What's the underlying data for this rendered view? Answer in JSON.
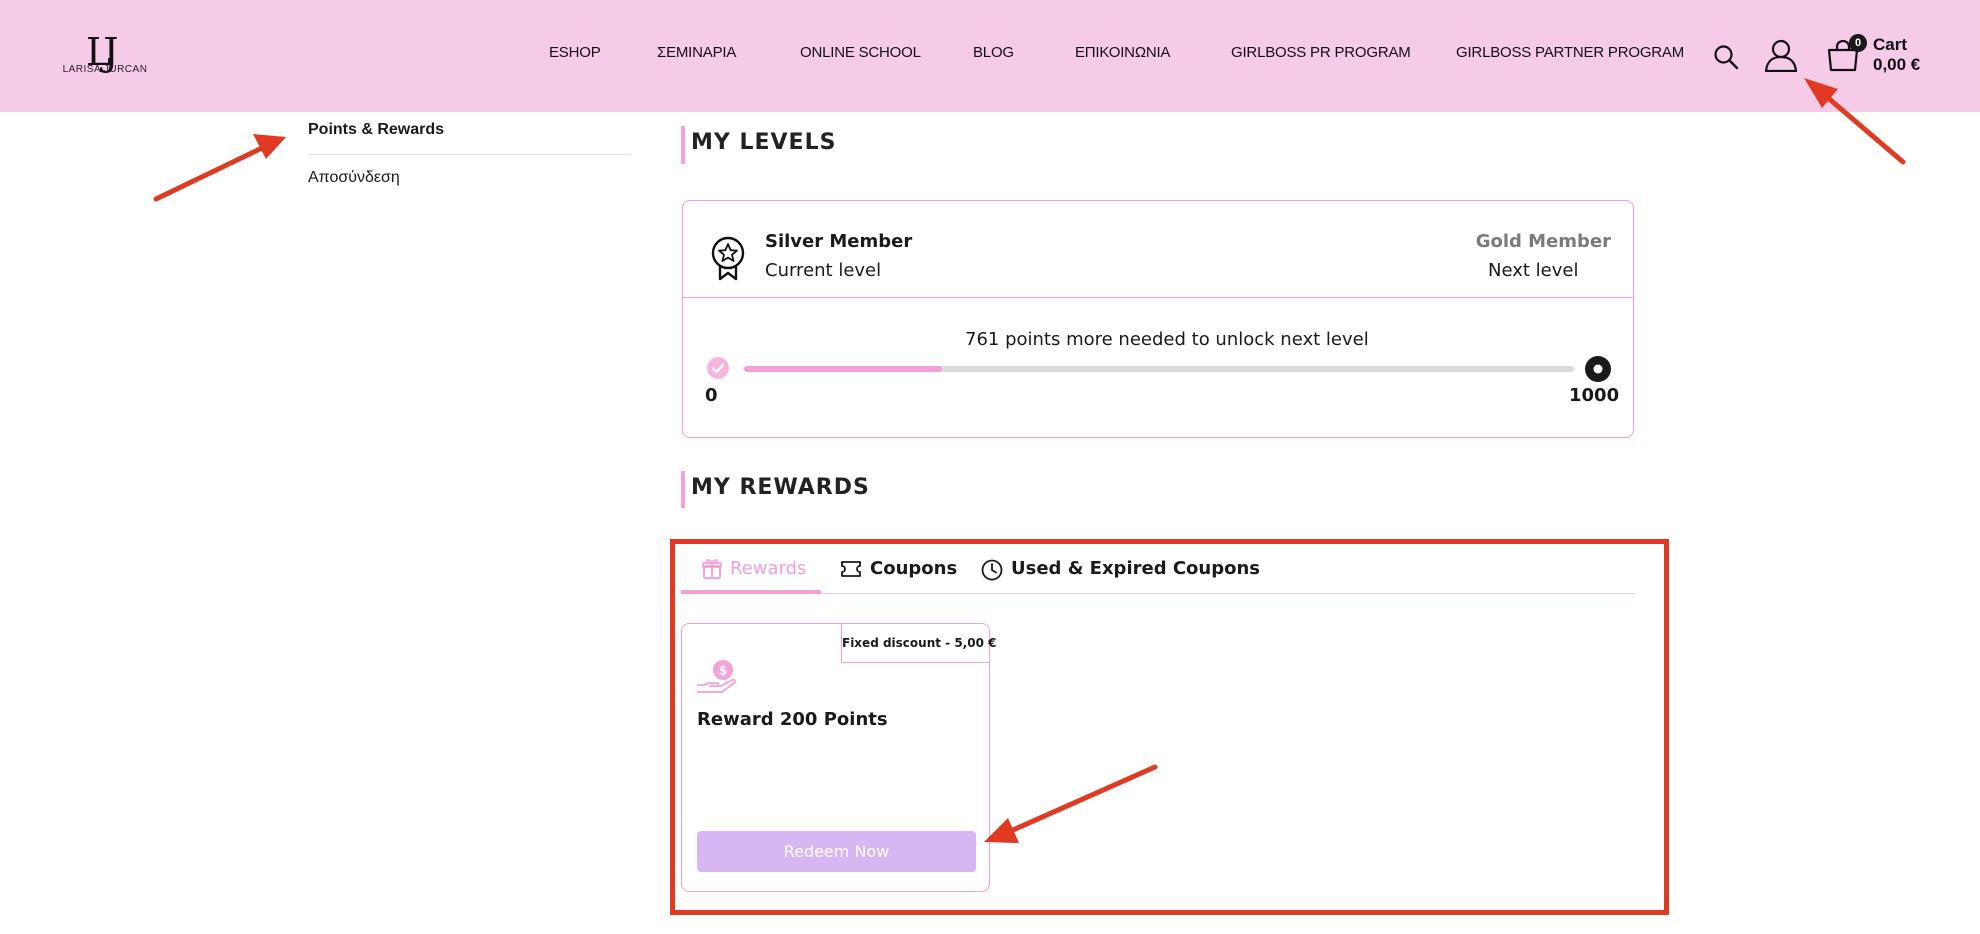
{
  "header": {
    "logo_text": "LJ",
    "logo_brand": "LARISA JURCAN",
    "nav": [
      "ESHOP",
      "ΣΕΜΙΝΑΡΙΑ",
      "ONLINE SCHOOL",
      "BLOG",
      "ΕΠΙΚΟΙΝΩΝΙΑ",
      "GIRLBOSS PR PROGRAM",
      "GIRLBOSS PARTNER PROGRAM"
    ],
    "icons": [
      "search-icon",
      "user-icon",
      "bag-icon"
    ],
    "cart_count": "0",
    "cart_label": "Cart",
    "cart_total": "0,00 €"
  },
  "sidebar": {
    "items": [
      "Points & Rewards",
      "Αποσύνδεση"
    ]
  },
  "levels": {
    "title": "MY LEVELS",
    "current_name": "Silver Member",
    "current_caption": "Current level",
    "next_name": "Gold Member",
    "next_caption": "Next level",
    "progress_text": "761 points more needed to unlock next level",
    "min": "0",
    "max": "1000",
    "progress_fraction": 0.239
  },
  "rewards": {
    "title": "MY REWARDS",
    "tabs": [
      "Rewards",
      "Coupons",
      "Used & Expired Coupons"
    ],
    "active_tab": "Rewards",
    "card": {
      "tag": "Fixed discount - 5,00 €",
      "title": "Reward 200 Points",
      "button": "Redeem Now"
    }
  },
  "colors": {
    "header_bg": "#f6cbe8",
    "accent_pink": "#f29fd6",
    "button_purple": "#d8b6f3",
    "annotation_red": "#e03a22"
  }
}
